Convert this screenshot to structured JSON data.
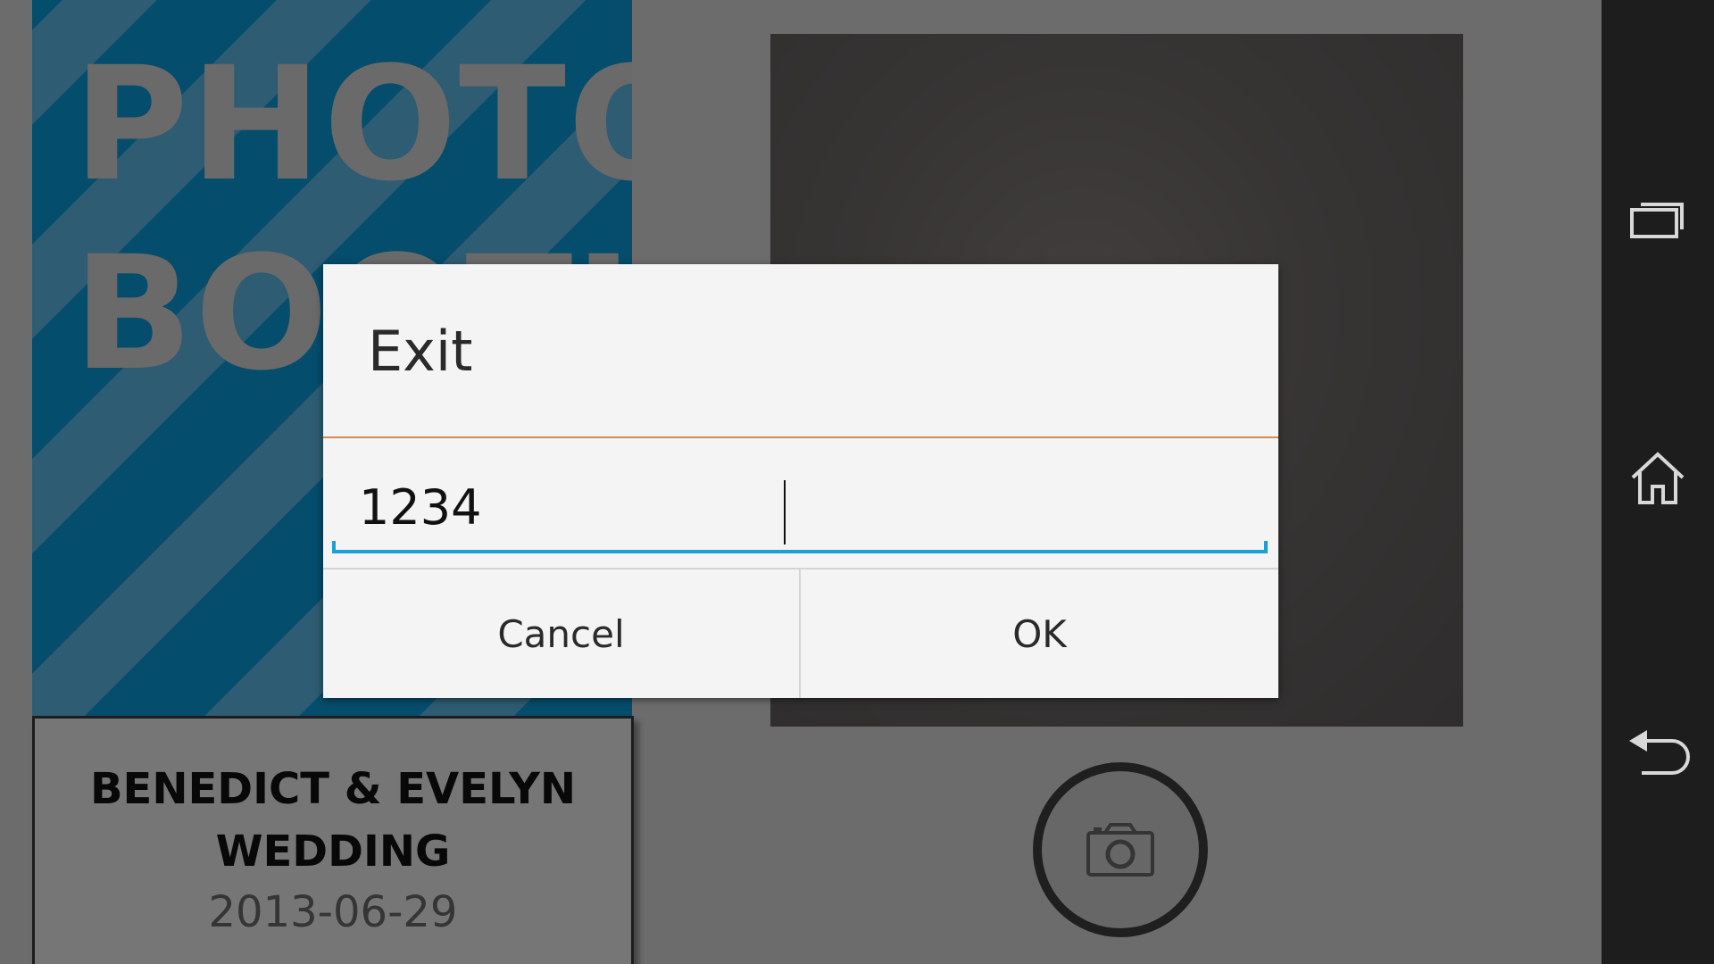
{
  "app": {
    "poster_title": "PHOTO\nBOOTH",
    "event": {
      "name": "BENEDICT & EVELYN WEDDING",
      "date": "2013-06-29"
    },
    "shutter_icon": "camera-icon"
  },
  "dialog": {
    "title": "Exit",
    "input_value": "1234",
    "cancel_label": "Cancel",
    "ok_label": "OK"
  },
  "nav_bar": {
    "icons": [
      "recent-apps-icon",
      "home-icon",
      "back-icon"
    ]
  },
  "colors": {
    "poster_stripe_dark": "#0a9ad8",
    "poster_stripe_light": "#5cb8e4",
    "title_divider": "#d88a4e",
    "input_accent": "#1d9fd6",
    "nav_bar": "#1d1d1d"
  }
}
